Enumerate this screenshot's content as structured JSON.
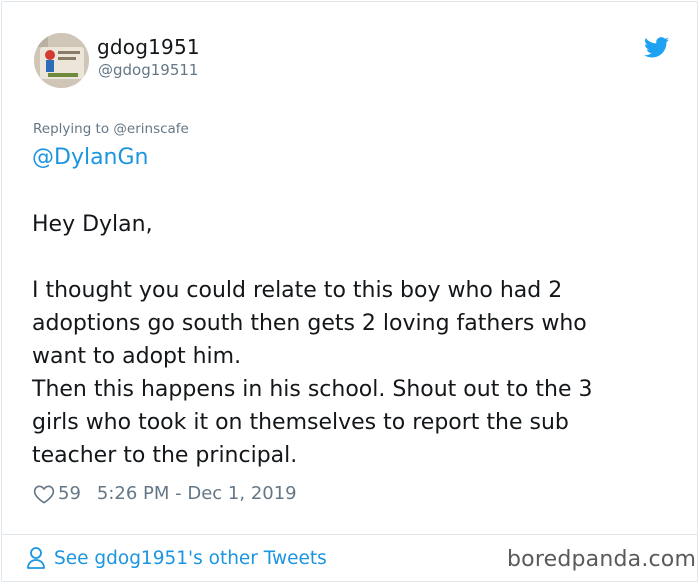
{
  "user": {
    "display_name": "gdog1951",
    "handle": "@gdog19511",
    "avatar_icon": "profile-photo"
  },
  "brand": {
    "icon": "twitter-bird-icon",
    "color": "#1DA1F2"
  },
  "reply": {
    "prefix": "Replying to",
    "target": "@erinscafe"
  },
  "tweet": {
    "mention": "@DylanGn",
    "greeting": "Hey Dylan,",
    "lines": [
      "I thought you could relate to this boy who had 2",
      "adoptions go south then gets 2 loving fathers who",
      "want to adopt him.",
      "Then this happens in his school. Shout out to the 3",
      "girls who took it on themselves to report the sub",
      "teacher to the principal."
    ]
  },
  "meta": {
    "likes": "59",
    "timestamp": "5:26 PM - Dec 1, 2019"
  },
  "footer": {
    "other_tweets_label": "See gdog1951's other Tweets",
    "watermark": "boredpanda.com"
  },
  "colors": {
    "link": "#1b95e0",
    "secondary_text": "#657786",
    "primary_text": "#14171a",
    "border": "#e1e8ed"
  }
}
